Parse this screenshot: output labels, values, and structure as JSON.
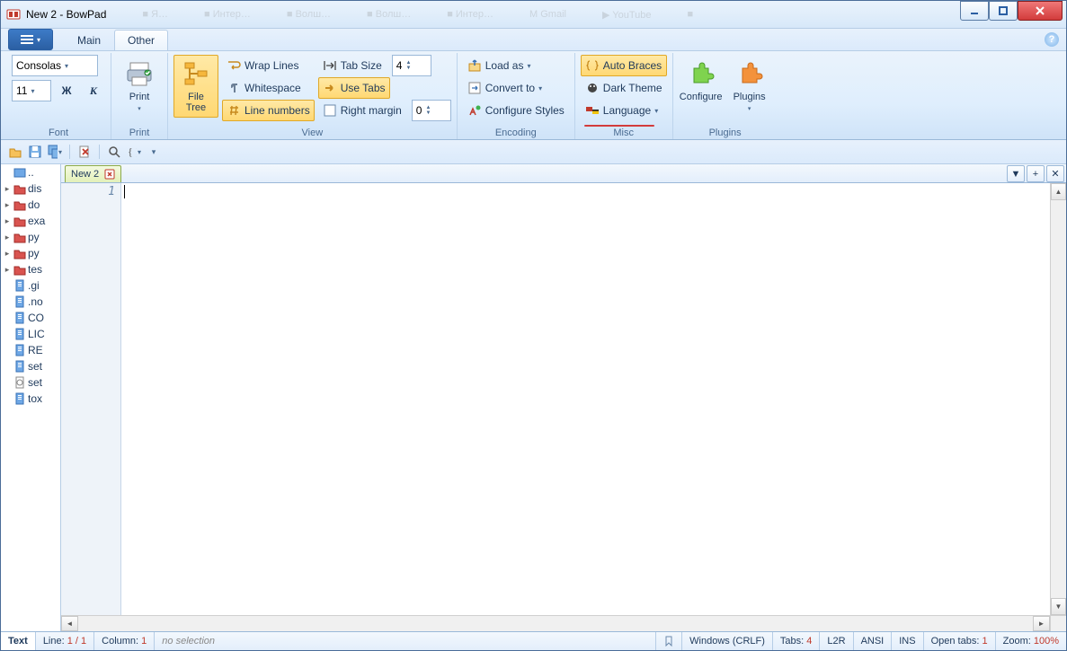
{
  "window": {
    "title": "New 2 - BowPad"
  },
  "browser_ghost_tabs": [
    "Яндекс",
    "Интерпретаторы…",
    "Волшебное кольцо",
    "Волшебное кольцо",
    "Интерпретаторы…",
    "Gmail",
    "YouTube",
    "…"
  ],
  "ribbon": {
    "tabs": {
      "main": "Main",
      "other": "Other",
      "active": "other"
    },
    "groups": {
      "font": {
        "label": "Font",
        "font_name": "Consolas",
        "font_size": "11",
        "bold": "Ж",
        "italic": "К"
      },
      "print": {
        "label": "Print",
        "print_btn": "Print"
      },
      "view": {
        "label": "View",
        "filetree_btn": "File\nTree",
        "wraplines": "Wrap Lines",
        "whitespace": "Whitespace",
        "linenumbers": "Line numbers",
        "tabsize_lbl": "Tab Size",
        "tabsize_val": "4",
        "usetabs": "Use Tabs",
        "rightmargin_lbl": "Right margin",
        "rightmargin_val": "0"
      },
      "encoding": {
        "label": "Encoding",
        "loadas": "Load as",
        "convertto": "Convert to",
        "cfgstyles": "Configure Styles"
      },
      "misc": {
        "label": "Misc",
        "autobraces": "Auto Braces",
        "darktheme": "Dark Theme",
        "language": "Language"
      },
      "plugins": {
        "label": "Plugins",
        "configure": "Configure",
        "plugins": "Plugins"
      }
    }
  },
  "editor_tab": {
    "name": "New 2",
    "line_number": "1"
  },
  "filetree": {
    "root": "..",
    "items": [
      {
        "t": "folder",
        "n": "dis"
      },
      {
        "t": "folder",
        "n": "do"
      },
      {
        "t": "folder",
        "n": "exa"
      },
      {
        "t": "folder",
        "n": "py"
      },
      {
        "t": "folder",
        "n": "py"
      },
      {
        "t": "folder",
        "n": "tes"
      },
      {
        "t": "file",
        "n": ".gi"
      },
      {
        "t": "file",
        "n": ".no"
      },
      {
        "t": "file",
        "n": "CO"
      },
      {
        "t": "file",
        "n": "LIC"
      },
      {
        "t": "file",
        "n": "RE"
      },
      {
        "t": "file",
        "n": "set"
      },
      {
        "t": "cfg",
        "n": "set"
      },
      {
        "t": "file",
        "n": "tox"
      }
    ]
  },
  "status": {
    "lexer": "Text",
    "line_lbl": "Line:",
    "line_val": "1 / 1",
    "col_lbl": "Column:",
    "col_val": "1",
    "sel": "no selection",
    "eol": "Windows (CRLF)",
    "tabs_lbl": "Tabs:",
    "tabs_val": "4",
    "dir": "L2R",
    "enc": "ANSI",
    "ovr": "INS",
    "opentabs_lbl": "Open tabs:",
    "opentabs_val": "1",
    "zoom_lbl": "Zoom:",
    "zoom_val": "100%"
  }
}
